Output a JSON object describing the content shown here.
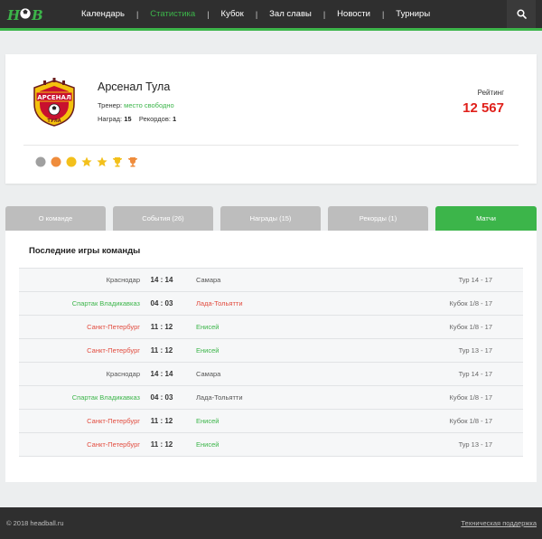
{
  "header": {
    "logo_text": "HOB",
    "nav": [
      {
        "label": "Календарь",
        "active": false
      },
      {
        "label": "Статистика",
        "active": true
      },
      {
        "label": "Кубок",
        "active": false
      },
      {
        "label": "Зал славы",
        "active": false
      },
      {
        "label": "Новости",
        "active": false
      },
      {
        "label": "Турниры",
        "active": false
      }
    ],
    "separator": "|",
    "search_icon": "search-icon"
  },
  "team": {
    "name": "Арсенал Тула",
    "crest_text_top": "АРСЕНАЛ",
    "crest_text_bottom": "ТУЛА",
    "coach_label": "Тренер:",
    "coach_value": "место свободно",
    "awards_label": "Наград:",
    "awards_count": "15",
    "records_label": "Рекордов:",
    "records_count": "1",
    "rating_label": "Рейтинг",
    "rating_value": "12 567",
    "badges": [
      {
        "icon": "gray-circle-icon",
        "color": "#a0a0a0"
      },
      {
        "icon": "orange-circle-icon",
        "color": "#ef8c3c"
      },
      {
        "icon": "yellow-circle-icon",
        "color": "#f3c01b"
      },
      {
        "icon": "star-icon",
        "color": "#f3c01b"
      },
      {
        "icon": "star-icon",
        "color": "#f3c01b"
      },
      {
        "icon": "trophy-icon",
        "color": "#f3c01b"
      },
      {
        "icon": "trophy-icon",
        "color": "#ef8c3c"
      }
    ]
  },
  "tabs": [
    {
      "label": "О команде",
      "active": false
    },
    {
      "label": "События (26)",
      "active": false
    },
    {
      "label": "Награды (15)",
      "active": false
    },
    {
      "label": "Рекорды (1)",
      "active": false
    },
    {
      "label": "Матчи",
      "active": true
    }
  ],
  "matches": {
    "title": "Последние игры команды",
    "rows": [
      {
        "home": "Краснодар",
        "home_status": "neutral",
        "score": "14 : 14",
        "away": "Самара",
        "away_status": "neutral",
        "round": "Тур 14 - 17"
      },
      {
        "home": "Спартак Владикавказ",
        "home_status": "win",
        "score": "04 : 03",
        "away": "Лада-Тольятти",
        "away_status": "loss",
        "round": "Кубок 1/8 - 17"
      },
      {
        "home": "Санкт-Петербург",
        "home_status": "loss",
        "score": "11 : 12",
        "away": "Енисей",
        "away_status": "win",
        "round": "Кубок 1/8 - 17"
      },
      {
        "home": "Санкт-Петербург",
        "home_status": "loss",
        "score": "11 : 12",
        "away": "Енисей",
        "away_status": "win",
        "round": "Тур 13 - 17"
      },
      {
        "home": "Краснодар",
        "home_status": "neutral",
        "score": "14 : 14",
        "away": "Самара",
        "away_status": "neutral",
        "round": "Тур 14 - 17"
      },
      {
        "home": "Спартак Владикавказ",
        "home_status": "win",
        "score": "04 : 03",
        "away": "Лада-Тольятти",
        "away_status": "neutral",
        "round": "Кубок 1/8 - 17"
      },
      {
        "home": "Санкт-Петербург",
        "home_status": "loss",
        "score": "11 : 12",
        "away": "Енисей",
        "away_status": "win",
        "round": "Кубок 1/8 - 17"
      },
      {
        "home": "Санкт-Петербург",
        "home_status": "loss",
        "score": "11 : 12",
        "away": "Енисей",
        "away_status": "win",
        "round": "Тур 13 - 17"
      }
    ]
  },
  "footer": {
    "copyright": "© 2018 headball.ru",
    "support_link": "Техническая поддержка"
  },
  "colors": {
    "accent": "#3cb54a",
    "rating": "#e0201b",
    "loss": "#e24c3f",
    "header_bg": "#2f2f2f"
  }
}
